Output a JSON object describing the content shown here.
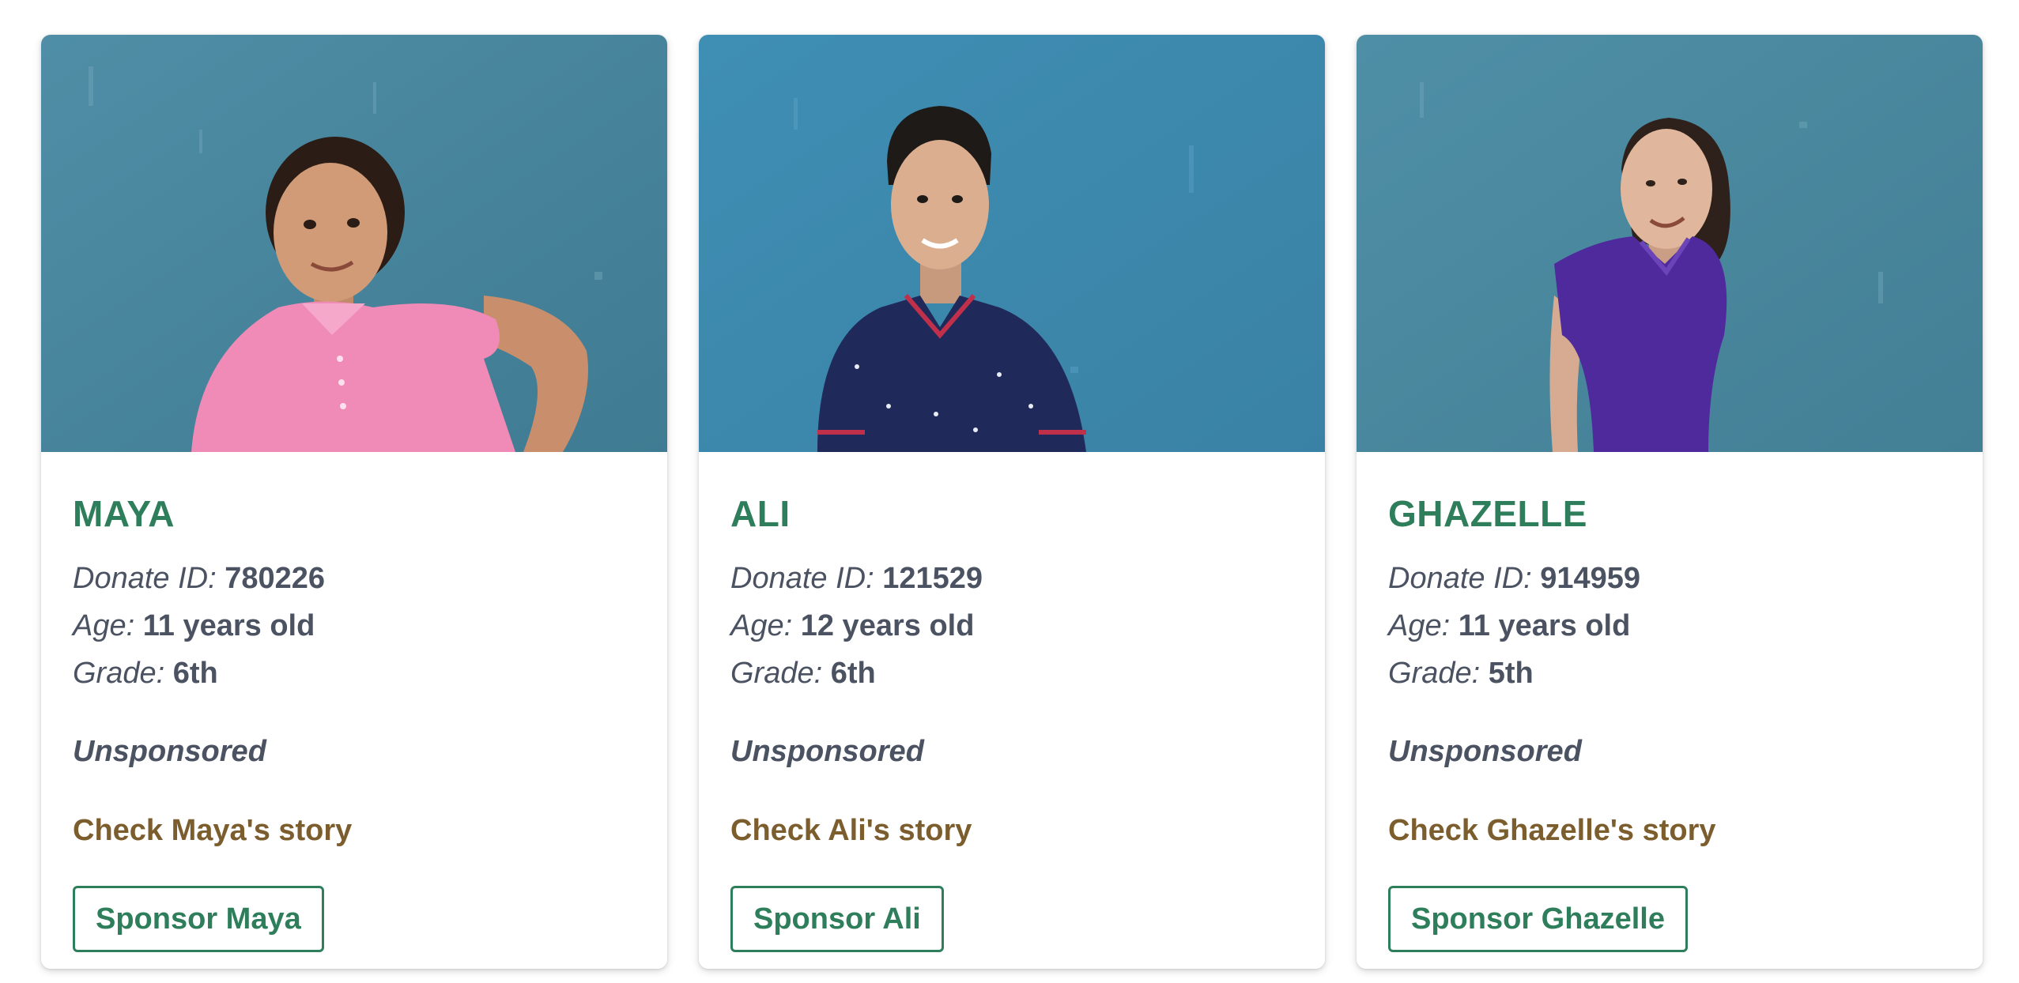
{
  "children": [
    {
      "name": "MAYA",
      "donate_id_label": "Donate ID:",
      "donate_id": "780226",
      "age_label": "Age:",
      "age": "11 years old",
      "grade_label": "Grade:",
      "grade": "6th",
      "status": "Unsponsored",
      "story_link": "Check Maya's story",
      "sponsor_button": "Sponsor Maya",
      "shirt_color": "#f08ab6"
    },
    {
      "name": "ALI",
      "donate_id_label": "Donate ID:",
      "donate_id": "121529",
      "age_label": "Age:",
      "age": "12 years old",
      "grade_label": "Grade:",
      "grade": "6th",
      "status": "Unsponsored",
      "story_link": "Check Ali's story",
      "sponsor_button": "Sponsor Ali",
      "shirt_color": "#1f2a5a"
    },
    {
      "name": "GHAZELLE",
      "donate_id_label": "Donate ID:",
      "donate_id": "914959",
      "age_label": "Age:",
      "age": "11 years old",
      "grade_label": "Grade:",
      "grade": "5th",
      "status": "Unsponsored",
      "story_link": "Check Ghazelle's story",
      "sponsor_button": "Sponsor Ghazelle",
      "shirt_color": "#4f2a9c"
    }
  ],
  "colors": {
    "name_green": "#2e7d5b",
    "text_gray": "#4b5262",
    "story_brown": "#7c5e2e",
    "photo_wall": "#4a8aa2"
  }
}
